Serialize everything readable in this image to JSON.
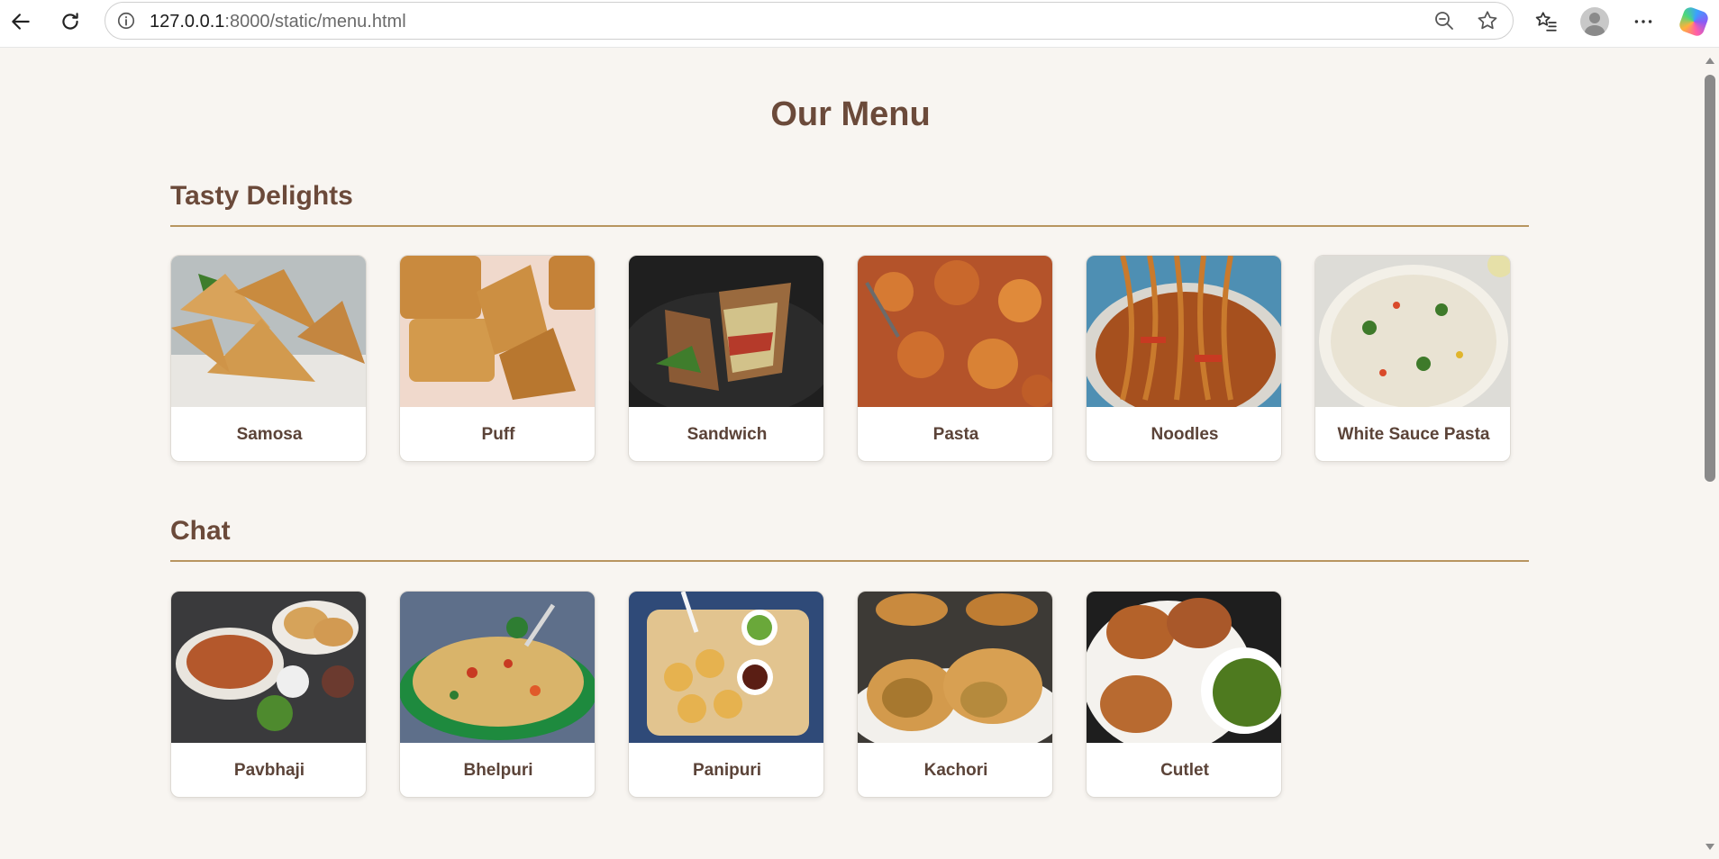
{
  "browser": {
    "url_host": "127.0.0.1",
    "url_path": ":8000/static/menu.html"
  },
  "page": {
    "title": "Our Menu",
    "sections": [
      {
        "title": "Tasty Delights",
        "items": [
          {
            "label": "Samosa"
          },
          {
            "label": "Puff"
          },
          {
            "label": "Sandwich"
          },
          {
            "label": "Pasta"
          },
          {
            "label": "Noodles"
          },
          {
            "label": "White Sauce Pasta"
          }
        ]
      },
      {
        "title": "Chat",
        "items": [
          {
            "label": "Pavbhaji"
          },
          {
            "label": "Bhelpuri"
          },
          {
            "label": "Panipuri"
          },
          {
            "label": "Kachori"
          },
          {
            "label": "Cutlet"
          }
        ]
      }
    ]
  },
  "colors": {
    "page_bg": "#f8f5f1",
    "heading": "#6b4a3a",
    "rule": "#b89560",
    "card_bg": "#ffffff"
  }
}
